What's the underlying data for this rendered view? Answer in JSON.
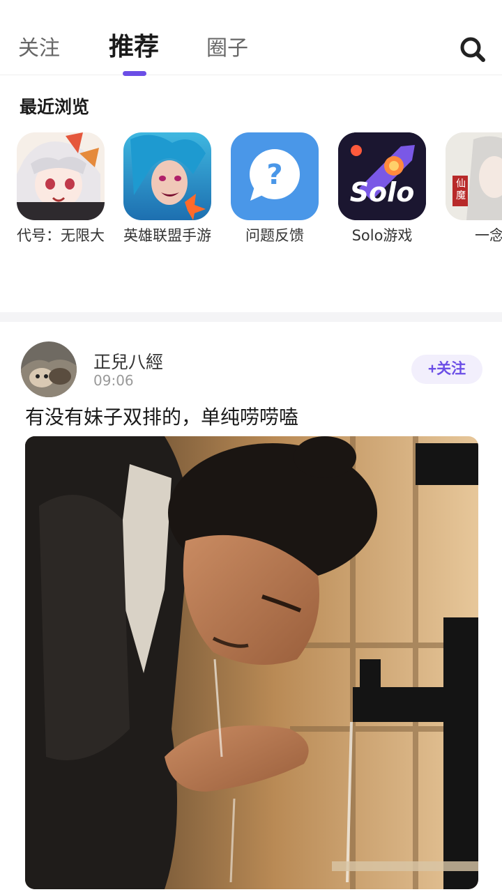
{
  "tabs": [
    {
      "label": "关注"
    },
    {
      "label": "推荐"
    },
    {
      "label": "圈子"
    }
  ],
  "colors": {
    "accent": "#6b4ee6",
    "follow_bg": "#f2effc"
  },
  "recent": {
    "title": "最近浏览",
    "apps": [
      {
        "name": "代号：无限大",
        "icon": "anime-girl-game-icon"
      },
      {
        "name": "英雄联盟手游",
        "icon": "league-of-legends-icon"
      },
      {
        "name": "问题反馈",
        "icon": "question-bubble-icon"
      },
      {
        "name": "Solo游戏",
        "icon": "solo-rocket-icon",
        "icon_text": "Solo"
      },
      {
        "name": "一念",
        "icon": "white-hair-character-icon",
        "icon_text": "仙魔"
      }
    ]
  },
  "post": {
    "username": "正兒八經",
    "time": "09:06",
    "follow_label": "+关注",
    "text": "有没有妹子双排的，单纯唠唠嗑",
    "image": "photo-man-washing-face"
  }
}
